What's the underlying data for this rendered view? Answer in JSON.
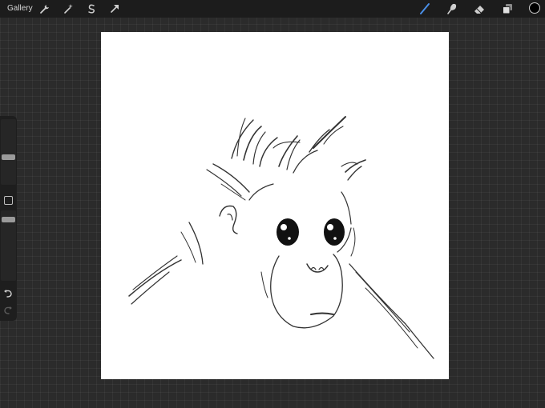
{
  "toolbar": {
    "gallery_label": "Gallery",
    "left_tools": [
      "wrench-icon",
      "magic-wand-icon",
      "selection-icon",
      "transform-arrow-icon"
    ],
    "right_tools": [
      "brush-icon",
      "smudge-icon",
      "eraser-icon",
      "layers-icon"
    ],
    "active_tool": "brush-icon",
    "active_color": "#4a8fe8",
    "current_color": "#000000"
  },
  "sidebar": {
    "brush_size": 0.6,
    "opacity": 0.75,
    "icons": [
      "modify-square-icon",
      "undo-icon",
      "redo-icon"
    ]
  },
  "canvas": {
    "background": "#ffffff",
    "subject": "monkey-sketch"
  }
}
